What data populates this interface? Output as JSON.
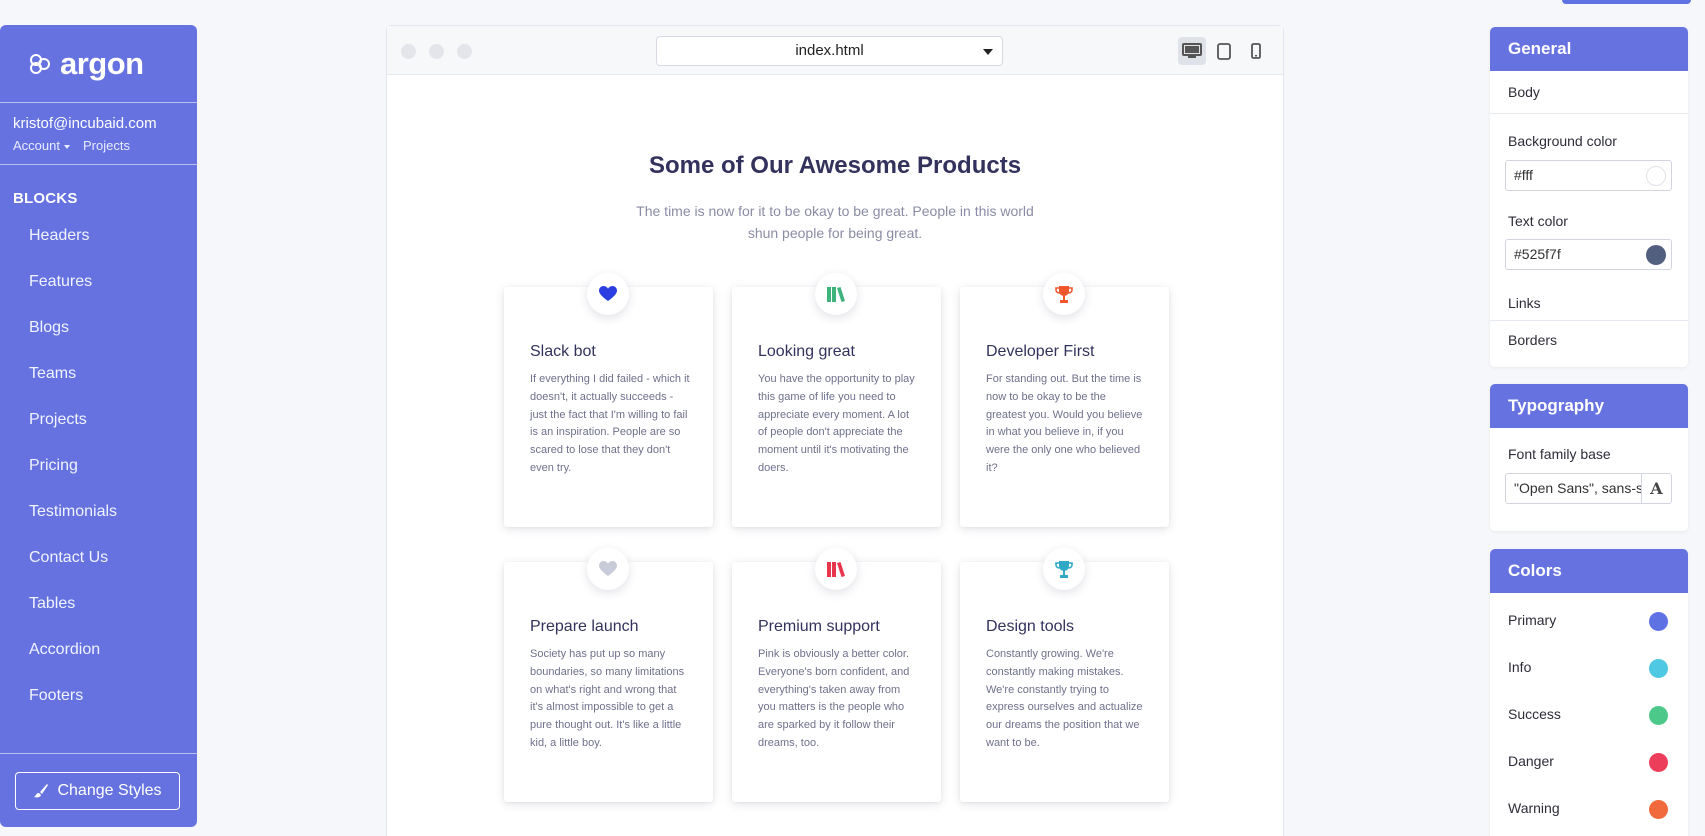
{
  "sidebar": {
    "logo_text": "argon",
    "user_email": "kristof@incubaid.com",
    "account_label": "Account",
    "projects_label": "Projects",
    "blocks_title": "BLOCKS",
    "items": [
      "Headers",
      "Features",
      "Blogs",
      "Teams",
      "Projects",
      "Pricing",
      "Testimonials",
      "Contact Us",
      "Tables",
      "Accordion",
      "Footers"
    ],
    "change_styles_label": "Change Styles"
  },
  "preview": {
    "file_name": "index.html",
    "active_device": "desktop",
    "title": "Some of Our Awesome Products",
    "subtitle": "The time is now for it to be okay to be great. People in this world shun people for being great.",
    "cards": [
      {
        "icon": "heart-icon",
        "icon_color": "#2b3ee0",
        "title": "Slack bot",
        "text": "If everything I did failed - which it doesn't, it actually succeeds - just the fact that I'm willing to fail is an inspiration. People are so scared to lose that they don't even try."
      },
      {
        "icon": "books-icon",
        "icon_color": "#3fb37c",
        "title": "Looking great",
        "text": "You have the opportunity to play this game of life you need to appreciate every moment. A lot of people don't appreciate the moment until it's motivating the doers."
      },
      {
        "icon": "trophy-icon",
        "icon_color": "#f0562b",
        "title": "Developer First",
        "text": "For standing out. But the time is now to be okay to be the greatest you. Would you believe in what you believe in, if you were the only one who believed it?"
      },
      {
        "icon": "heart-icon",
        "icon_color": "#c8ccd8",
        "title": "Prepare launch",
        "text": "Society has put up so many boundaries, so many limitations on what's right and wrong that it's almost impossible to get a pure thought out. It's like a little kid, a little boy."
      },
      {
        "icon": "books-icon",
        "icon_color": "#e8364f",
        "title": "Premium support",
        "text": "Pink is obviously a better color. Everyone's born confident, and everything's taken away from you matters is the people who are sparked by it follow their dreams, too."
      },
      {
        "icon": "trophy-icon",
        "icon_color": "#2fa9c6",
        "title": "Design tools",
        "text": "Constantly growing. We're constantly making mistakes. We're constantly trying to express ourselves and actualize our dreams the position that we want to be."
      }
    ]
  },
  "general": {
    "title": "General",
    "body_label": "Body",
    "bg_label": "Background color",
    "bg_value": "#fff",
    "text_label": "Text color",
    "text_value": "#525f7f",
    "links_label": "Links",
    "borders_label": "Borders"
  },
  "typography": {
    "title": "Typography",
    "font_label": "Font family base",
    "font_value": "\"Open Sans\", sans-serif"
  },
  "colors": {
    "title": "Colors",
    "items": [
      {
        "label": "Primary",
        "color": "#5e72e4"
      },
      {
        "label": "Info",
        "color": "#4fc8e3"
      },
      {
        "label": "Success",
        "color": "#4cc98a"
      },
      {
        "label": "Danger",
        "color": "#ec3e5a"
      },
      {
        "label": "Warning",
        "color": "#f06a3e"
      }
    ]
  }
}
